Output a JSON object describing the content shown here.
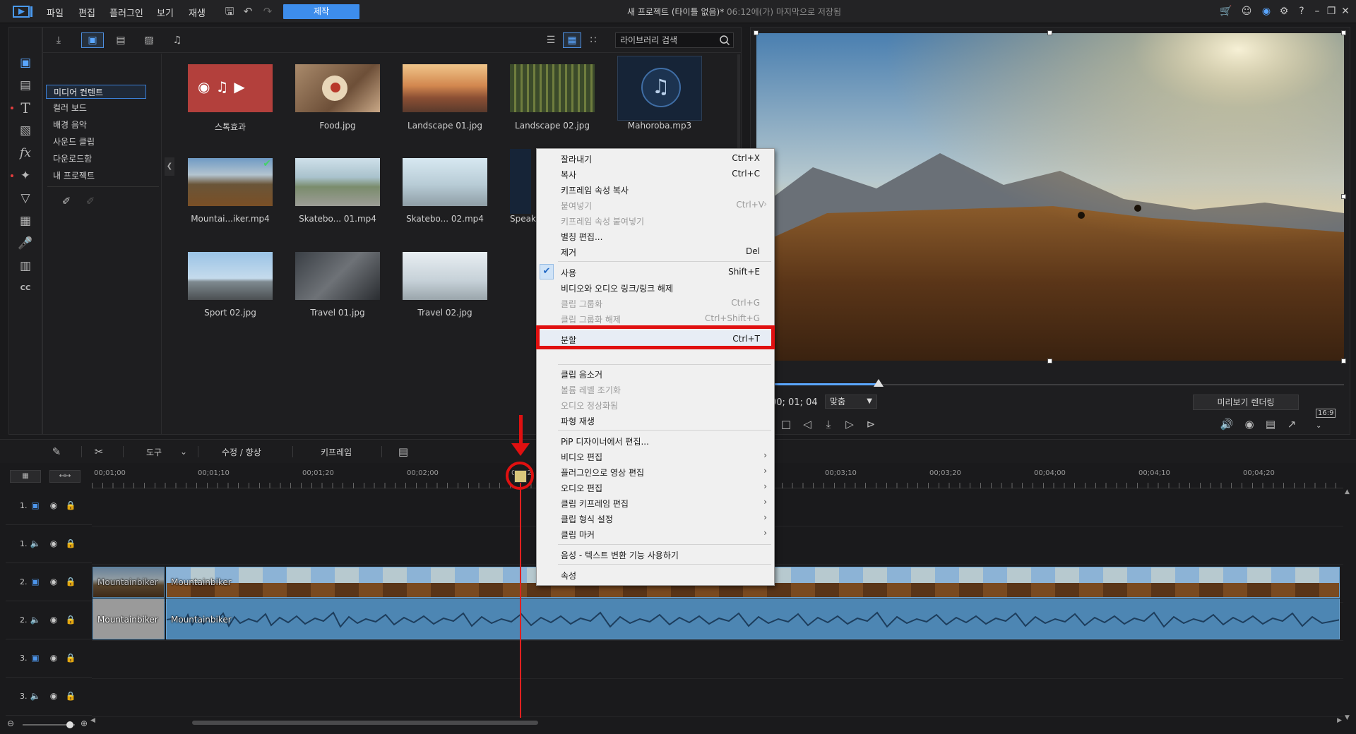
{
  "menubar": {
    "items": [
      "파일",
      "편집",
      "플러그인",
      "보기",
      "재생"
    ],
    "produce_label": "제작"
  },
  "window": {
    "title": "새 프로젝트 (타이틀 없음)*",
    "saved_status": "06:12에(가) 마지막으로 저장됨"
  },
  "library": {
    "search_placeholder": "라이브러리 검색",
    "categories": [
      "미디어 컨텐트",
      "컬러 보드",
      "배경 음악",
      "사운드 클립",
      "다운로드함",
      "내 프로젝트"
    ],
    "items": [
      {
        "label": "스톡효과"
      },
      {
        "label": "Food.jpg"
      },
      {
        "label": "Landscape 01.jpg"
      },
      {
        "label": "Landscape 02.jpg"
      },
      {
        "label": "Mahoroba.mp3"
      },
      {
        "label": "Mountai...iker.mp4"
      },
      {
        "label": "Skatebo... 01.mp4"
      },
      {
        "label": "Skatebo... 02.mp4"
      },
      {
        "label": "Speak"
      },
      {
        "label": "Sport 02.jpg"
      },
      {
        "label": "Travel 01.jpg"
      },
      {
        "label": "Travel 02.jpg"
      }
    ]
  },
  "preview": {
    "timecode": "00; 01; 04",
    "fit_label": "맞춤",
    "render_label": "미리보기 렌더링",
    "ratio_label": "16:9"
  },
  "timeline": {
    "tools_label": "도구",
    "fix_label": "수정 / 향상",
    "keyframe_label": "키프레임",
    "ruler": [
      "00;01;00",
      "00;01;10",
      "00;01;20",
      "00;02;00",
      "00;02",
      "00;03;10",
      "00;03;20",
      "00;04;00",
      "00;04;10",
      "00;04;20"
    ],
    "tracks": [
      {
        "num": "1.",
        "type": "video"
      },
      {
        "num": "1.",
        "type": "audio"
      },
      {
        "num": "2.",
        "type": "video"
      },
      {
        "num": "2.",
        "type": "audio"
      },
      {
        "num": "3.",
        "type": "video"
      },
      {
        "num": "3.",
        "type": "audio"
      }
    ],
    "clip_name": "Mountainbiker"
  },
  "context_menu": {
    "items": [
      {
        "label": "잘라내기",
        "shortcut": "Ctrl+X"
      },
      {
        "label": "복사",
        "shortcut": "Ctrl+C"
      },
      {
        "label": "키프레임 속성 복사",
        "shortcut": ""
      },
      {
        "label": "붙여넣기",
        "shortcut": "Ctrl+V"
      },
      {
        "label": "키프레임 속성 붙여넣기",
        "shortcut": ""
      },
      {
        "label": "별칭 편집...",
        "shortcut": ""
      },
      {
        "label": "제거",
        "shortcut": "Del"
      },
      {
        "label": "사용",
        "shortcut": "Shift+E"
      },
      {
        "label": "비디오와 오디오 링크/링크 해제",
        "shortcut": ""
      },
      {
        "label": "클립 그룹화",
        "shortcut": "Ctrl+G"
      },
      {
        "label": "클립 그룹화 해제",
        "shortcut": "Ctrl+Shift+G"
      },
      {
        "label": "분할",
        "shortcut": "Ctrl+T"
      },
      {
        "label": "클립 음소거",
        "shortcut": ""
      },
      {
        "label": "볼륨 레벨 조기화",
        "shortcut": ""
      },
      {
        "label": "오디오 정상화됨",
        "shortcut": ""
      },
      {
        "label": "파형 재생",
        "shortcut": ""
      },
      {
        "label": "PiP 디자이너에서 편집...",
        "shortcut": ""
      },
      {
        "label": "비디오 편집",
        "shortcut": ""
      },
      {
        "label": "플러그인으로 영상 편집",
        "shortcut": ""
      },
      {
        "label": "오디오 편집",
        "shortcut": ""
      },
      {
        "label": "클립 키프레임 편집",
        "shortcut": ""
      },
      {
        "label": "클립 형식 설정",
        "shortcut": ""
      },
      {
        "label": "클립 마커",
        "shortcut": ""
      },
      {
        "label": "음성 - 텍스트 변환 기능 사용하기",
        "shortcut": ""
      },
      {
        "label": "속성",
        "shortcut": ""
      }
    ]
  },
  "colors": {
    "accent": "#3d8dec",
    "highlight": "#e01010",
    "playhead": "#e02020"
  }
}
